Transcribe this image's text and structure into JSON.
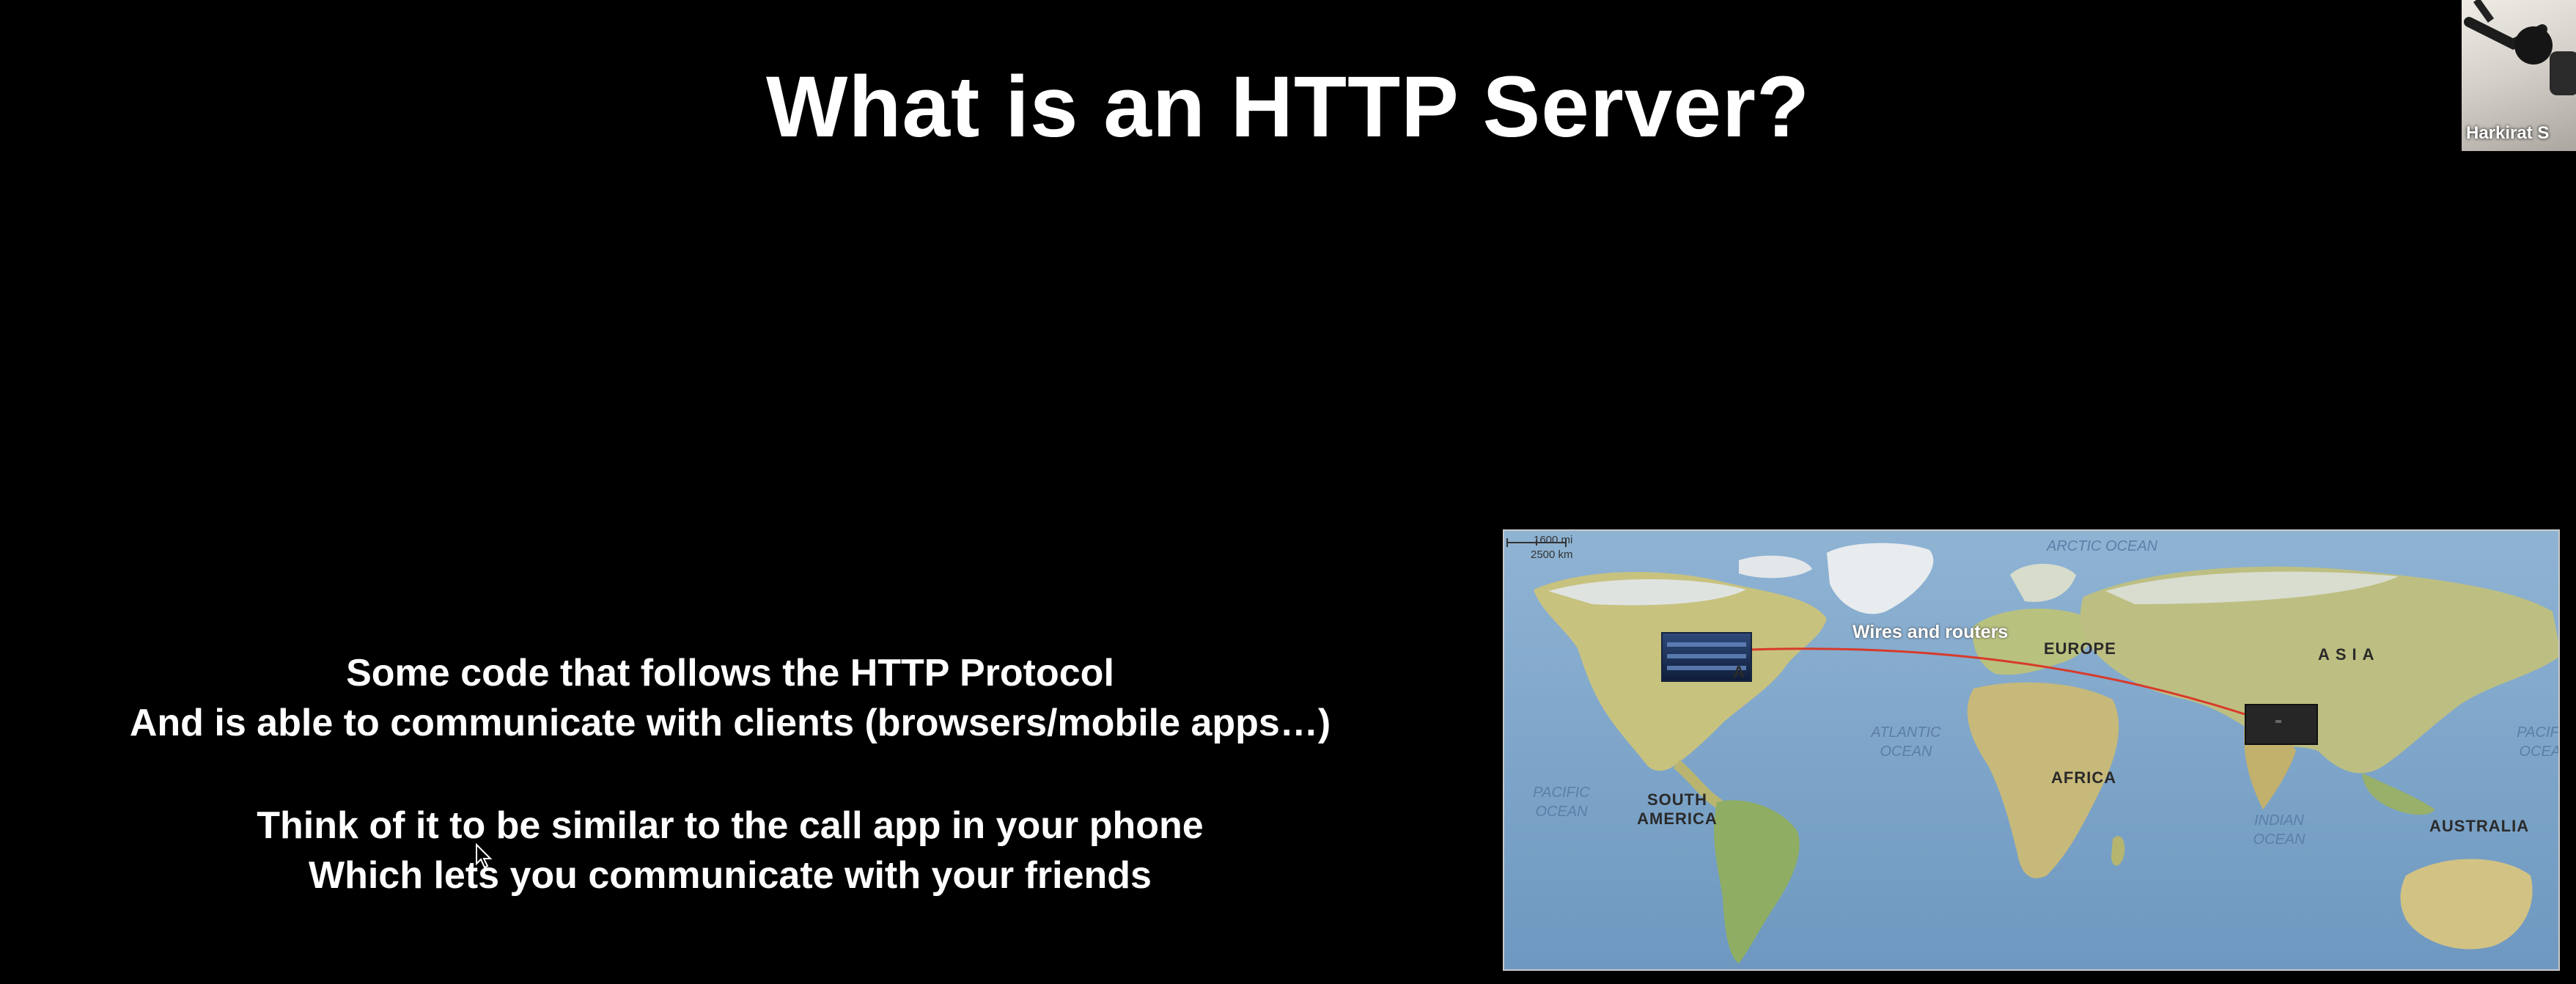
{
  "slide": {
    "title": "What is an HTTP Server?",
    "lines": [
      "Some code that follows the HTTP Protocol",
      "And is able to communicate with clients (browsers/mobile apps…)",
      "Think of it to be similar to the call app in your phone",
      "Which lets you communicate with your friends"
    ]
  },
  "map": {
    "scale_miles": "1600 mi",
    "scale_km": "2500 km",
    "connection_label": "Wires and routers",
    "oceans": {
      "arctic": "ARCTIC OCEAN",
      "atlantic": "ATLANTIC OCEAN",
      "pacific_left": "PACIFIC OCEAN",
      "pacific_right": "PACIFIC OCEAN",
      "indian": "INDIAN OCEAN"
    },
    "continents": {
      "north_america_partial": "A",
      "europe": "EUROPE",
      "asia": "ASIA",
      "africa": "AFRICA",
      "south_america": "SOUTH AMERICA",
      "australia": "AUSTRALIA"
    },
    "colors": {
      "ocean": "#7fa6c9",
      "land": "#c9bf8a",
      "connection_line": "#d83a2a"
    }
  },
  "participant": {
    "name": "Harkirat S"
  }
}
